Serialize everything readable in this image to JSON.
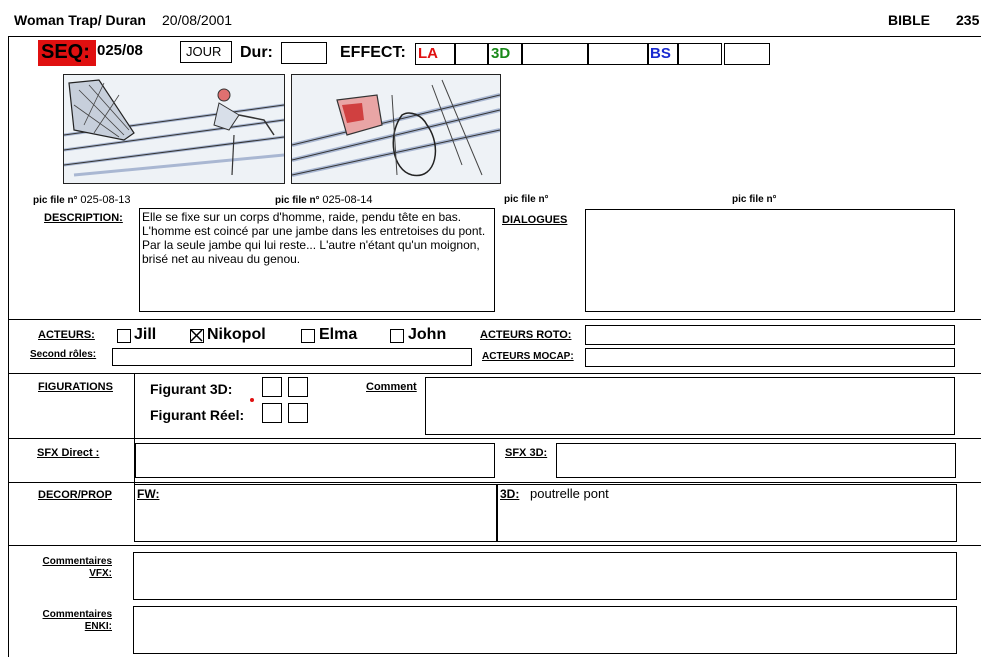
{
  "header": {
    "project": "Woman Trap/ Duran",
    "date": "20/08/2001",
    "bible": "BIBLE",
    "page": "235"
  },
  "seq": {
    "label": "SEQ:",
    "value": "025/08"
  },
  "jour": "JOUR",
  "dur_label": "Dur:",
  "effect": {
    "label": "EFFECT:",
    "la": "LA",
    "three_d": "3D",
    "bs": "BS"
  },
  "pics": [
    {
      "label": "pic file n°",
      "value": "025-08-13"
    },
    {
      "label": "pic file n°",
      "value": "025-08-14"
    },
    {
      "label": "pic file n°",
      "value": ""
    },
    {
      "label": "pic file n°",
      "value": ""
    }
  ],
  "description": {
    "label": "DESCRIPTION:",
    "text": "Elle se fixe sur un corps d'homme, raide, pendu tête en bas. L'homme est coincé par une jambe dans les entretoises du pont. Par la seule jambe qui lui reste... L'autre n'étant qu'un moignon, brisé net au niveau du genou."
  },
  "dialogues": {
    "label": "DIALOGUES",
    "text": ""
  },
  "acteurs": {
    "label": "ACTEURS:",
    "options": [
      {
        "name": "Jill",
        "checked": false
      },
      {
        "name": "Nikopol",
        "checked": true
      },
      {
        "name": "Elma",
        "checked": false
      },
      {
        "name": "John",
        "checked": false
      }
    ],
    "roto_label": "ACTEURS ROTO:",
    "mocap_label": "ACTEURS MOCAP:",
    "second_label": "Second rôles:"
  },
  "figurations": {
    "label": "FIGURATIONS",
    "f3d": "Figurant 3D:",
    "freel": "Figurant Réel:",
    "comment": "Comment"
  },
  "sfx": {
    "direct_label": "SFX  Direct :",
    "three_d_label": "SFX 3D:"
  },
  "decor": {
    "label": "DECOR/PROP",
    "fw_label": "FW:",
    "three_d_label": "3D:",
    "three_d_value": "poutrelle pont"
  },
  "comments": {
    "vfx_label1": "Commentaires",
    "vfx_label2": "VFX:",
    "enki_label1": "Commentaires",
    "enki_label2": "ENKI:"
  },
  "colors": {
    "seq_red": "#e01010",
    "la_red": "#e01010",
    "green": "#1a8a1a",
    "blue": "#1a2bd0"
  }
}
